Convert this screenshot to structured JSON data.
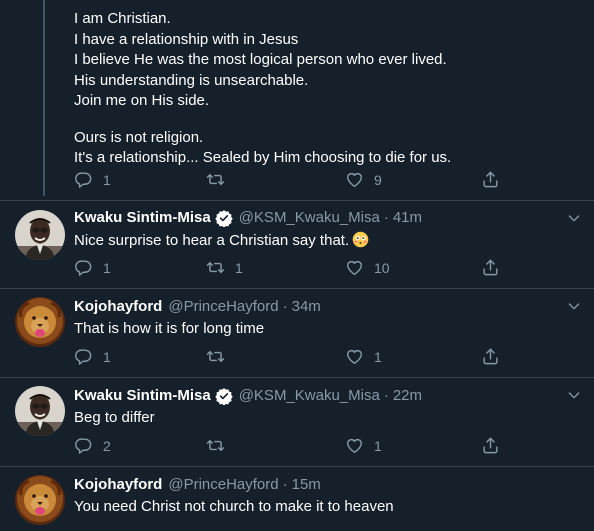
{
  "first_tweet": {
    "lines": [
      "I am Christian.",
      "I have a relationship with in Jesus",
      "I believe He was the most logical person who ever lived.",
      "His understanding is unsearchable.",
      "Join me on His side.",
      "Ours is not religion.",
      "It's a relationship... Sealed by Him choosing to die for us."
    ],
    "replies": "1",
    "retweets": "",
    "likes": "9"
  },
  "replies": [
    {
      "name": "Kwaku Sintim-Misa",
      "verified": true,
      "handle": "@KSM_Kwaku_Misa",
      "time": "41m",
      "text": "Nice surprise to hear a Christian say that.",
      "emoji": "flushed-face-emoji",
      "replies": "1",
      "retweets": "1",
      "likes": "10"
    },
    {
      "name": "Kojohayford",
      "verified": false,
      "handle": "@PrinceHayford",
      "time": "34m",
      "text": "That is how it is for long time",
      "replies": "1",
      "retweets": "",
      "likes": "1"
    },
    {
      "name": "Kwaku Sintim-Misa",
      "verified": true,
      "handle": "@KSM_Kwaku_Misa",
      "time": "22m",
      "text": "Beg to differ",
      "replies": "2",
      "retweets": "",
      "likes": "1"
    },
    {
      "name": "Kojohayford",
      "verified": false,
      "handle": "@PrinceHayford",
      "time": "15m",
      "text": "You need Christ not church to make it to heaven"
    }
  ],
  "separator": "·",
  "colors": {
    "background": "#15202b",
    "secondary_text": "#8899a6",
    "divider": "#38444d",
    "verified_blue": "#ffffff"
  }
}
